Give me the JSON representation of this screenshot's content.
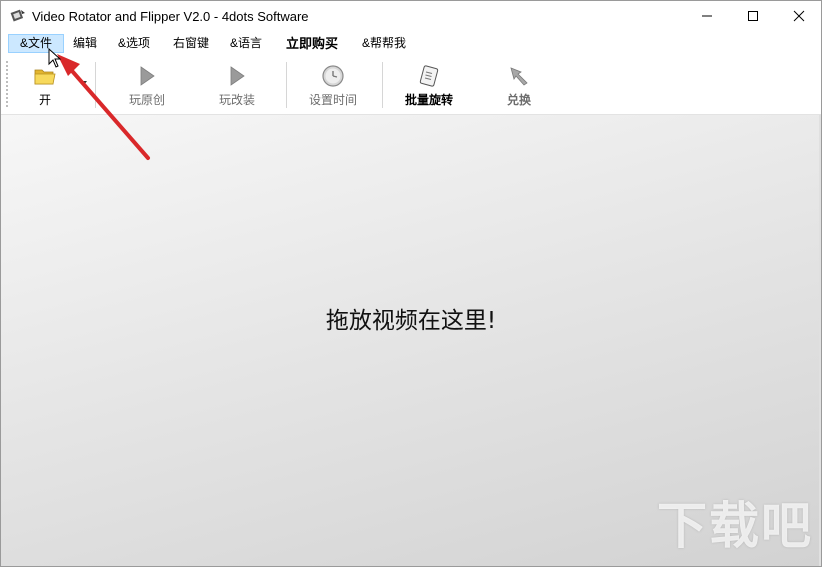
{
  "window": {
    "title": "Video Rotator and Flipper V2.0 - 4dots Software"
  },
  "menubar": {
    "items": [
      {
        "label": "&文件"
      },
      {
        "label": "编辑"
      },
      {
        "label": "&选项"
      },
      {
        "label": "右窗键"
      },
      {
        "label": "&语言"
      },
      {
        "label": "立即购买"
      },
      {
        "label": "&帮帮我"
      }
    ]
  },
  "toolbar": {
    "open": {
      "label": "开",
      "icon": "folder-icon"
    },
    "play_original": {
      "label": "玩原创",
      "icon": "play-icon"
    },
    "play_modified": {
      "label": "玩改装",
      "icon": "play-icon"
    },
    "set_time": {
      "label": "设置时间",
      "icon": "clock-icon"
    },
    "batch_rotate": {
      "label": "批量旋转",
      "icon": "scroll-icon"
    },
    "convert": {
      "label": "兑换",
      "icon": "convert-icon"
    }
  },
  "main": {
    "drop_hint": "拖放视频在这里!"
  },
  "watermark": {
    "text": "下载吧"
  },
  "colors": {
    "menu_active_bg": "#cce8ff",
    "annotation_arrow": "#d9282a"
  }
}
